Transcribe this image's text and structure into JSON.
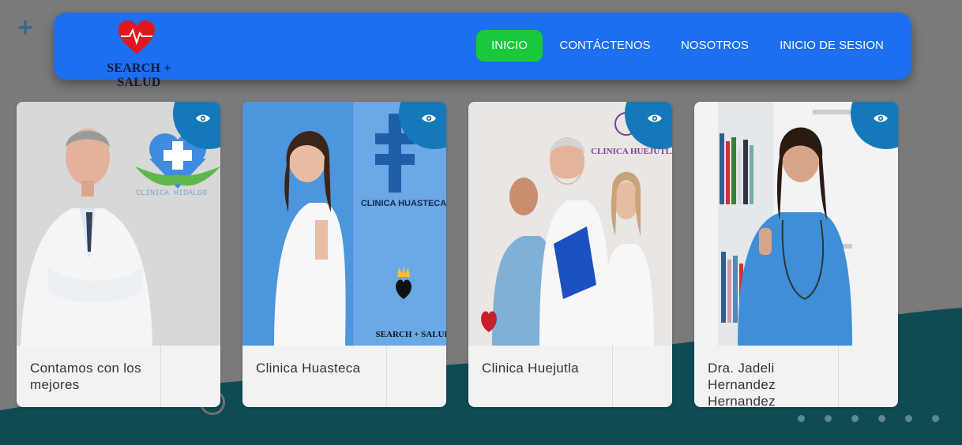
{
  "brand": {
    "name": "SEARCH + SALUD",
    "logo_icon": "heart-pulse-icon"
  },
  "nav": {
    "items": [
      {
        "label": "INICIO",
        "active": true
      },
      {
        "label": "CONTÁCTENOS",
        "active": false
      },
      {
        "label": "NOSOTROS",
        "active": false
      },
      {
        "label": "INICIO DE SESION",
        "active": false
      }
    ]
  },
  "cards": [
    {
      "title": "Contamos con los mejores",
      "image": "doctor-arms-crossed",
      "logo_text": "CLINICA HIDALGO"
    },
    {
      "title": "Clinica Huasteca",
      "image": "female-doctor-thumbs-up",
      "logo_text": "CLINICA HUASTECA",
      "watermark": "SEARCH + SALUD"
    },
    {
      "title": "Clinica Huejutla",
      "image": "medical-team",
      "logo_text": "CLINICA HUEJUTLA"
    },
    {
      "title": "Dra. Jadeli Hernandez Hernandez",
      "image": "nurse-thumbs-up",
      "logo_text": ""
    }
  ],
  "colors": {
    "navbar": "#1d6ef0",
    "active": "#19c93b",
    "corner": "#1579b9",
    "wave": "#0e4b52"
  }
}
